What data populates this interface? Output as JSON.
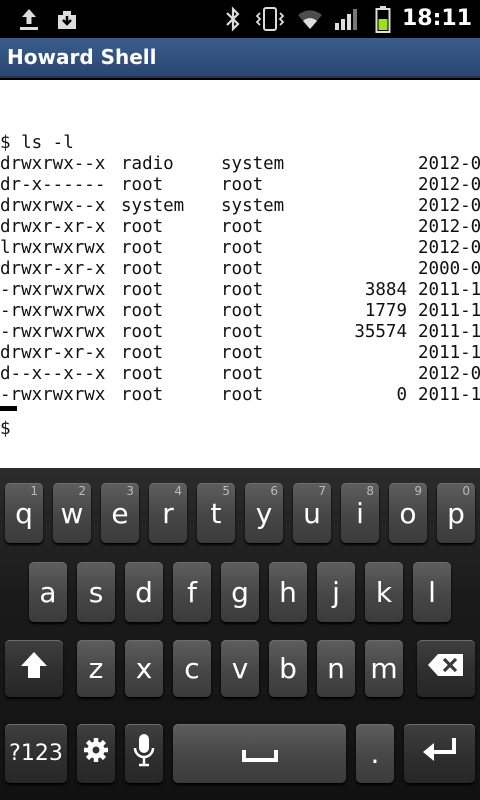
{
  "status_bar": {
    "time": "18:11",
    "icons": [
      "upload-icon",
      "download-icon",
      "bluetooth-icon",
      "vibrate-icon",
      "wifi-icon",
      "signal-icon",
      "battery-icon"
    ]
  },
  "app": {
    "title": "Howard Shell"
  },
  "terminal": {
    "command_line": "$ ls -l",
    "listing": [
      {
        "perm": "drwxrwx--x",
        "user": "radio",
        "group": "system",
        "size": "",
        "date": "2012-0"
      },
      {
        "perm": "dr-x------",
        "user": "root",
        "group": "root",
        "size": "",
        "date": "2012-0"
      },
      {
        "perm": "drwxrwx--x",
        "user": "system",
        "group": "system",
        "size": "",
        "date": "2012-0"
      },
      {
        "perm": "drwxr-xr-x",
        "user": "root",
        "group": "root",
        "size": "",
        "date": "2012-0"
      },
      {
        "perm": "lrwxrwxrwx",
        "user": "root",
        "group": "root",
        "size": "",
        "date": "2012-0"
      },
      {
        "perm": "drwxr-xr-x",
        "user": "root",
        "group": "root",
        "size": "",
        "date": "2000-0"
      },
      {
        "perm": "-rwxrwxrwx",
        "user": "root",
        "group": "root",
        "size": "3884",
        "date": "2011-1"
      },
      {
        "perm": "-rwxrwxrwx",
        "user": "root",
        "group": "root",
        "size": "1779",
        "date": "2011-1"
      },
      {
        "perm": "-rwxrwxrwx",
        "user": "root",
        "group": "root",
        "size": "35574",
        "date": "2011-1"
      },
      {
        "perm": "drwxr-xr-x",
        "user": "root",
        "group": "root",
        "size": "",
        "date": "2011-1"
      },
      {
        "perm": "d--x--x--x",
        "user": "root",
        "group": "root",
        "size": "",
        "date": "2012-0"
      },
      {
        "perm": "-rwxrwxrwx",
        "user": "root",
        "group": "root",
        "size": "0",
        "date": "2011-1"
      }
    ],
    "prompt": "$"
  },
  "keyboard": {
    "row1": [
      {
        "label": "q",
        "hint": "1"
      },
      {
        "label": "w",
        "hint": "2"
      },
      {
        "label": "e",
        "hint": "3"
      },
      {
        "label": "r",
        "hint": "4"
      },
      {
        "label": "t",
        "hint": "5"
      },
      {
        "label": "y",
        "hint": "6"
      },
      {
        "label": "u",
        "hint": "7"
      },
      {
        "label": "i",
        "hint": "8"
      },
      {
        "label": "o",
        "hint": "9"
      },
      {
        "label": "p",
        "hint": "0"
      }
    ],
    "row2": [
      "a",
      "s",
      "d",
      "f",
      "g",
      "h",
      "j",
      "k",
      "l"
    ],
    "row3": [
      "z",
      "x",
      "c",
      "v",
      "b",
      "n",
      "m"
    ],
    "symbols_label": "?123",
    "period_label": ".",
    "icons": {
      "shift": "shift-arrow-icon",
      "backspace": "backspace-icon",
      "settings": "gear-icon",
      "mic": "microphone-icon",
      "space": "spacebar-icon",
      "enter": "enter-icon"
    }
  }
}
